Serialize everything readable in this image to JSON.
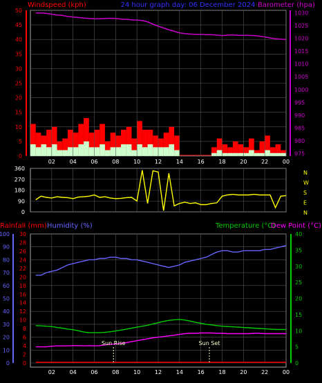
{
  "header": {
    "wind_title": "Windspeed (kph)",
    "center_title": "24 hour graph day: 06 December 2024",
    "baro_title": "Barometer (hpa)"
  },
  "footer": {
    "rain_title": "Rainfall (mm)",
    "hum_title": "Humidity (%)",
    "temp_title": "Temperature (°C)",
    "dew_title": "Dew Point (°C)",
    "sunrise_label": "Sun Rise",
    "sunset_label": "Sun Set"
  },
  "colors": {
    "wind_gust": "#ff0000",
    "wind_avg": "#ccffcc",
    "barometer": "#cc00cc",
    "direction": "#ffff00",
    "humidity": "#6666ff",
    "temperature": "#00cc00",
    "dewpoint": "#ff00ff",
    "rainfall": "#ff0000",
    "markers": "#ffffcc",
    "grid": "#555555"
  },
  "chart_data": [
    {
      "type": "area",
      "name": "wind",
      "x_ticks": [
        "02",
        "04",
        "06",
        "08",
        "10",
        "12",
        "14",
        "16",
        "18",
        "20",
        "22",
        "00"
      ],
      "left_axis": {
        "label": "Windspeed (kph)",
        "ticks": [
          0,
          5,
          10,
          15,
          20,
          25,
          30,
          35,
          40,
          45,
          50
        ],
        "ylim": [
          0,
          50
        ]
      },
      "right_axis": {
        "label": "Barometer (hpa)",
        "ticks": [
          975,
          980,
          985,
          990,
          995,
          1000,
          1005,
          1010,
          1015,
          1020,
          1025,
          1030
        ],
        "ylim": [
          974,
          1031
        ]
      },
      "x": [
        0.5,
        1,
        1.5,
        2,
        2.5,
        3,
        3.5,
        4,
        4.5,
        5,
        5.5,
        6,
        6.5,
        7,
        7.5,
        8,
        8.5,
        9,
        9.5,
        10,
        10.5,
        11,
        11.5,
        12,
        12.5,
        13,
        13.5,
        14,
        14.5,
        15,
        15.5,
        16,
        16.5,
        17,
        17.5,
        18,
        18.5,
        19,
        19.5,
        20,
        20.5,
        21,
        21.5,
        22,
        22.5,
        23,
        23.5,
        24
      ],
      "series": [
        {
          "name": "gust",
          "values": [
            11,
            8,
            7,
            9,
            10,
            5,
            6,
            9,
            8,
            11,
            13,
            8,
            9,
            11,
            5,
            8,
            7,
            9,
            10,
            6,
            12,
            9,
            9,
            7,
            6,
            8,
            10,
            7,
            0,
            0,
            0,
            0,
            0,
            0,
            3,
            6,
            4,
            3,
            5,
            4,
            3,
            6,
            2,
            5,
            7,
            3,
            4,
            2
          ]
        },
        {
          "name": "average",
          "values": [
            4,
            3,
            4,
            3,
            4,
            2,
            2,
            3,
            3,
            4,
            5,
            3,
            3,
            4,
            2,
            3,
            3,
            4,
            4,
            2,
            4,
            3,
            4,
            3,
            3,
            3,
            4,
            2,
            0,
            0,
            0,
            0,
            0,
            0,
            1,
            2,
            1,
            1,
            1,
            1,
            1,
            2,
            1,
            1,
            2,
            1,
            1,
            1
          ]
        },
        {
          "name": "barometer",
          "values": [
            1030,
            1030,
            1029.8,
            1029.5,
            1029.2,
            1029,
            1028.6,
            1028.4,
            1028.2,
            1028,
            1027.8,
            1027.7,
            1027.7,
            1027.8,
            1027.9,
            1027.8,
            1027.6,
            1027.5,
            1027.3,
            1027.2,
            1027,
            1026.5,
            1025.6,
            1024.8,
            1024.1,
            1023.4,
            1022.8,
            1022.2,
            1021.9,
            1021.7,
            1021.6,
            1021.6,
            1021.5,
            1021.5,
            1021.3,
            1021.1,
            1021.3,
            1021.4,
            1021.2,
            1021.2,
            1021.2,
            1021.1,
            1020.9,
            1020.6,
            1020.2,
            1019.9,
            1019.7,
            1019.6
          ]
        }
      ]
    },
    {
      "type": "line",
      "name": "wind_direction",
      "left_axis": {
        "ticks": [
          0,
          90,
          180,
          270,
          360
        ],
        "ylim": [
          0,
          360
        ]
      },
      "right_axis": {
        "ticks": [
          "N",
          "W",
          "S",
          "E",
          "N"
        ]
      },
      "x": [
        0.5,
        1,
        1.5,
        2,
        2.5,
        3,
        3.5,
        4,
        4.5,
        5,
        5.5,
        6,
        6.5,
        7,
        7.5,
        8,
        8.5,
        9,
        9.5,
        10,
        10.5,
        11,
        11.5,
        12,
        12.5,
        13,
        13.5,
        14,
        14.5,
        15,
        15.5,
        16,
        16.5,
        17,
        17.5,
        18,
        18.5,
        19,
        19.5,
        20,
        20.5,
        21,
        21.5,
        22,
        22.5,
        23,
        23.5,
        24
      ],
      "series": [
        {
          "name": "direction",
          "values": [
            100,
            130,
            120,
            115,
            125,
            120,
            118,
            110,
            122,
            125,
            130,
            140,
            120,
            125,
            115,
            110,
            112,
            118,
            120,
            90,
            345,
            70,
            340,
            330,
            10,
            320,
            50,
            70,
            80,
            70,
            75,
            60,
            60,
            70,
            75,
            130,
            140,
            145,
            140,
            140,
            140,
            145,
            140,
            140,
            140,
            35,
            130,
            135
          ]
        }
      ]
    },
    {
      "type": "line",
      "name": "temperature_humidity",
      "x_ticks": [
        "02",
        "04",
        "06",
        "08",
        "10",
        "12",
        "14",
        "16",
        "18",
        "20",
        "22",
        "00"
      ],
      "left_axis_humidity": {
        "label": "Humidity (%)",
        "ticks": [
          0,
          10,
          20,
          30,
          40,
          50,
          60,
          70,
          80,
          90,
          100
        ],
        "ylim": [
          0,
          100
        ]
      },
      "left_axis_rain": {
        "label": "Rainfall (mm)",
        "ticks": [
          0,
          2,
          4,
          6,
          8,
          10,
          12,
          14,
          16,
          18,
          20,
          22,
          24,
          26,
          28,
          30
        ],
        "ylim": [
          0,
          30
        ]
      },
      "right_axis": {
        "label": "Temperature (°C)",
        "ticks": [
          0,
          5,
          10,
          15,
          20,
          25,
          30,
          35,
          40
        ],
        "ylim": [
          0,
          40
        ]
      },
      "annotations": [
        {
          "label": "Sun Rise",
          "x": 7.8
        },
        {
          "label": "Sun Set",
          "x": 16.8
        }
      ],
      "x": [
        0.5,
        1,
        1.5,
        2,
        2.5,
        3,
        3.5,
        4,
        4.5,
        5,
        5.5,
        6,
        6.5,
        7,
        7.5,
        8,
        8.5,
        9,
        9.5,
        10,
        10.5,
        11,
        11.5,
        12,
        12.5,
        13,
        13.5,
        14,
        14.5,
        15,
        15.5,
        16,
        16.5,
        17,
        17.5,
        18,
        18.5,
        19,
        19.5,
        20,
        20.5,
        21,
        21.5,
        22,
        22.5,
        23,
        23.5,
        24
      ],
      "series": [
        {
          "name": "humidity",
          "values": [
            68,
            68,
            70,
            71,
            72,
            74,
            76,
            77,
            78,
            79,
            80,
            80,
            81,
            81,
            82,
            82,
            81,
            81,
            80,
            80,
            79,
            78,
            77,
            76,
            75,
            74,
            75,
            76,
            78,
            79,
            80,
            81,
            82,
            84,
            86,
            87,
            87,
            86,
            86,
            87,
            87,
            87,
            87,
            88,
            88,
            89,
            90,
            91
          ]
        },
        {
          "name": "temperature",
          "values": [
            11.6,
            11.5,
            11.4,
            11.3,
            11.0,
            10.8,
            10.5,
            10.3,
            10.0,
            9.6,
            9.4,
            9.4,
            9.4,
            9.5,
            9.7,
            9.9,
            10.2,
            10.5,
            10.8,
            11.1,
            11.4,
            11.7,
            12.1,
            12.5,
            12.9,
            13.2,
            13.4,
            13.5,
            13.3,
            13.0,
            12.6,
            12.3,
            12.0,
            11.8,
            11.6,
            11.4,
            11.3,
            11.2,
            11.1,
            11.0,
            10.9,
            10.8,
            10.7,
            10.6,
            10.5,
            10.4,
            10.4,
            10.4
          ]
        },
        {
          "name": "dewpoint",
          "values": [
            5.0,
            5.0,
            5.0,
            5.2,
            5.3,
            5.3,
            5.3,
            5.4,
            5.4,
            5.3,
            5.4,
            5.3,
            5.4,
            5.6,
            5.8,
            5.9,
            6.1,
            6.3,
            6.6,
            6.9,
            7.2,
            7.5,
            7.8,
            8.0,
            8.2,
            8.4,
            8.6,
            8.9,
            9.1,
            9.2,
            9.2,
            9.3,
            9.3,
            9.3,
            9.2,
            9.2,
            9.1,
            9.1,
            9.1,
            9.1,
            9.1,
            9.2,
            9.2,
            9.1,
            9.1,
            9.1,
            9.1,
            9.1
          ]
        },
        {
          "name": "rainfall",
          "values": [
            0,
            0,
            0,
            0,
            0,
            0,
            0,
            0,
            0,
            0,
            0,
            0,
            0,
            0,
            0,
            0,
            0,
            0,
            0,
            0,
            0,
            0,
            0,
            0,
            0,
            0,
            0,
            0,
            0,
            0,
            0,
            0,
            0,
            0,
            0,
            0,
            0,
            0,
            0,
            0,
            0,
            0,
            0,
            0,
            0,
            0,
            0,
            0
          ]
        }
      ]
    }
  ]
}
